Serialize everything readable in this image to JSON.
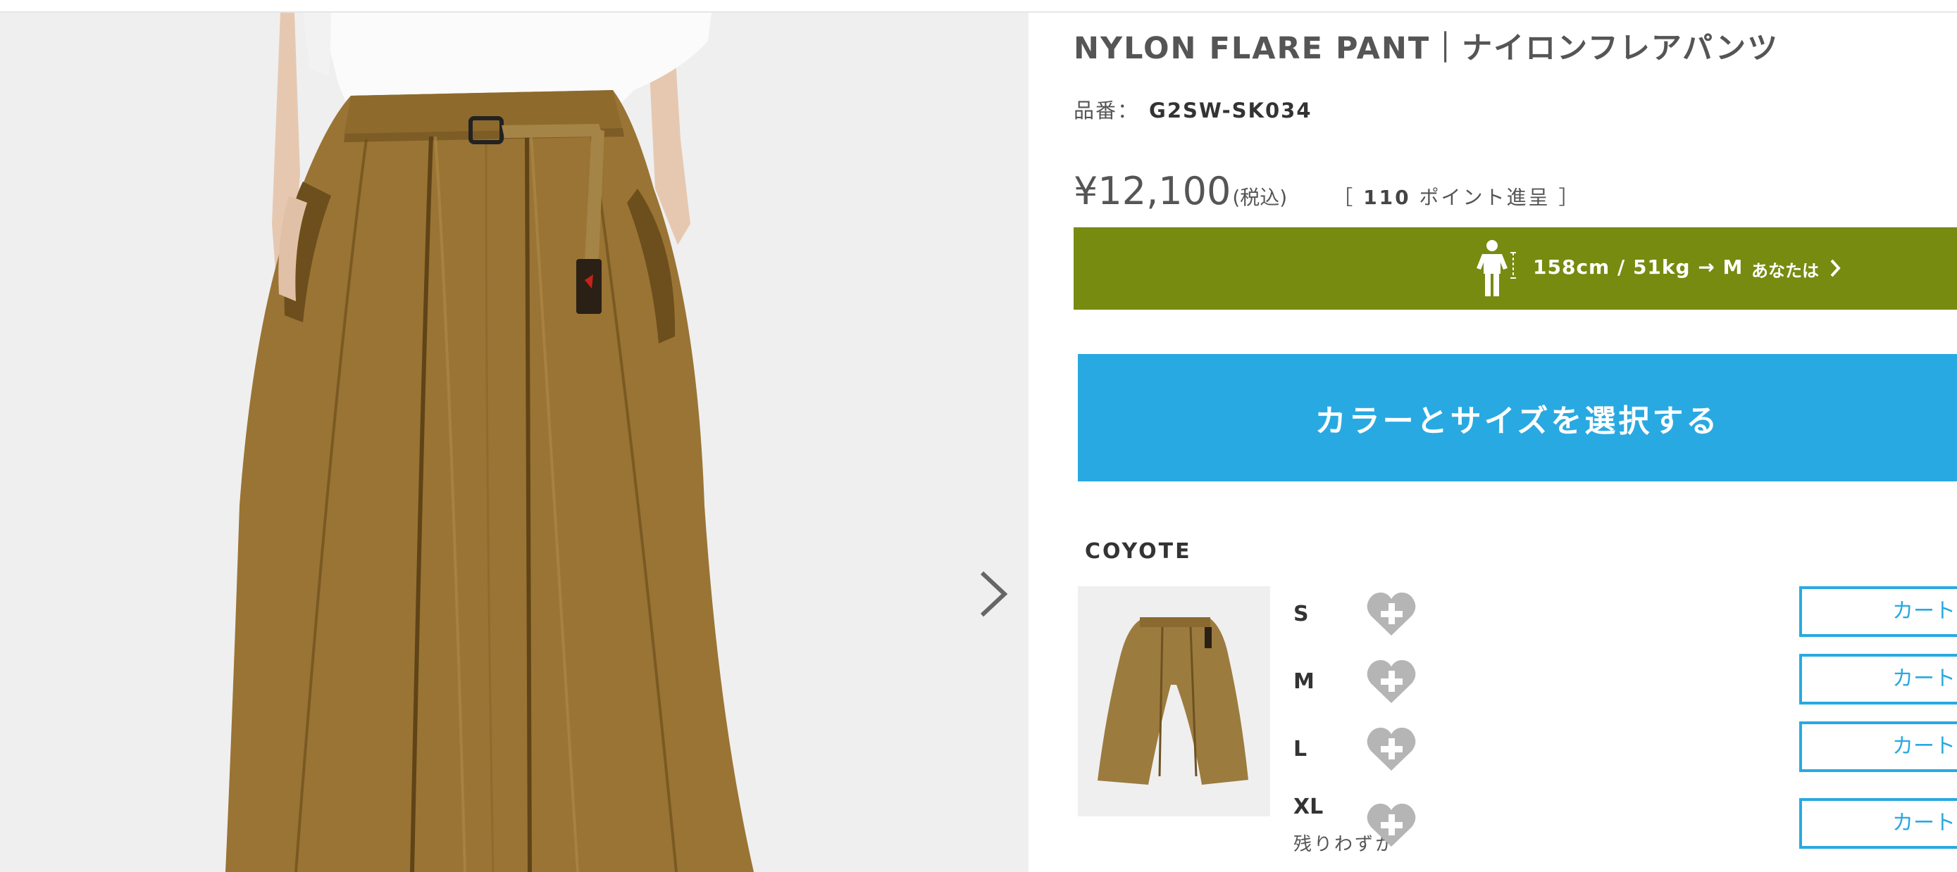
{
  "product": {
    "title": "NYLON FLARE PANT｜ナイロンフレアパンツ",
    "sku_label": "品番：",
    "sku": "G2SW-SK034",
    "price": "¥12,100",
    "tax_note": "(税込)",
    "points_prefix": "［",
    "points_value": "110",
    "points_suffix": "ポイント進呈 ］"
  },
  "size_advice": {
    "measurements": "158cm / 51kg → M",
    "you_label": "あなたは"
  },
  "select_button": {
    "label": "カラーとサイズを選択する"
  },
  "variant": {
    "color": "COYOTE",
    "sizes": [
      {
        "size": "S",
        "note": "",
        "cart_label": "カート"
      },
      {
        "size": "M",
        "note": "",
        "cart_label": "カート"
      },
      {
        "size": "L",
        "note": "",
        "cart_label": "カート"
      },
      {
        "size": "XL",
        "note": "残りわずか",
        "cart_label": "カート"
      }
    ]
  },
  "icons": {
    "next": "chevron-right-icon",
    "favorite": "heart-plus-icon",
    "size_guide": "person-size-icon"
  },
  "colors": {
    "size_banner": "#768b10",
    "primary": "#29a9e1",
    "heart": "#b5b5b5",
    "fabric": "#9a7434"
  }
}
